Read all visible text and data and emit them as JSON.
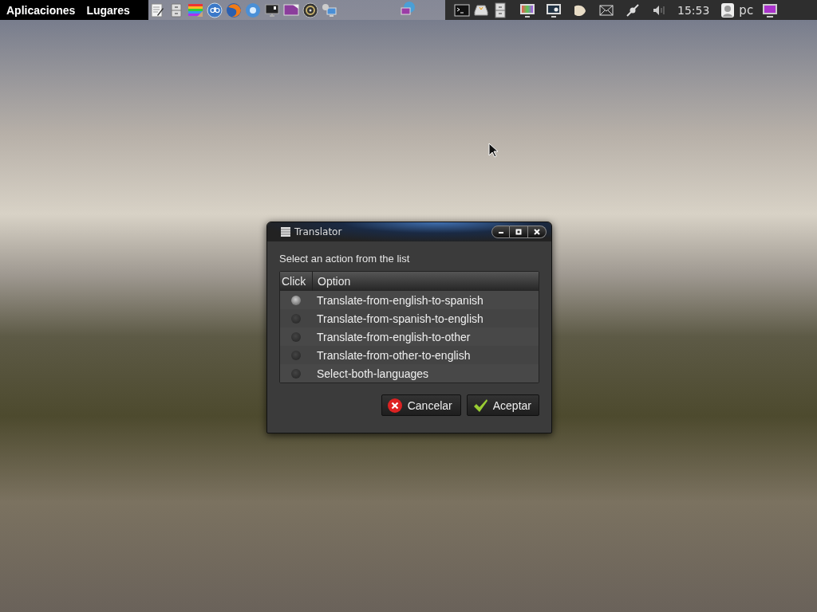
{
  "panel": {
    "menus": [
      {
        "label": "Aplicaciones"
      },
      {
        "label": "Lugares"
      }
    ],
    "clock": "15:53",
    "user": "pc"
  },
  "dialog": {
    "title": "Translator",
    "prompt": "Select an action from the list",
    "columns": [
      "Click",
      "Option"
    ],
    "rows": [
      {
        "option": "Translate-from-english-to-spanish",
        "selected": true
      },
      {
        "option": "Translate-from-spanish-to-english",
        "selected": false
      },
      {
        "option": "Translate-from-english-to-other",
        "selected": false
      },
      {
        "option": "Translate-from-other-to-english",
        "selected": false
      },
      {
        "option": "Select-both-languages",
        "selected": false
      }
    ],
    "buttons": [
      {
        "label": "Cancelar",
        "kind": "cancel"
      },
      {
        "label": "Aceptar",
        "kind": "ok"
      }
    ]
  }
}
